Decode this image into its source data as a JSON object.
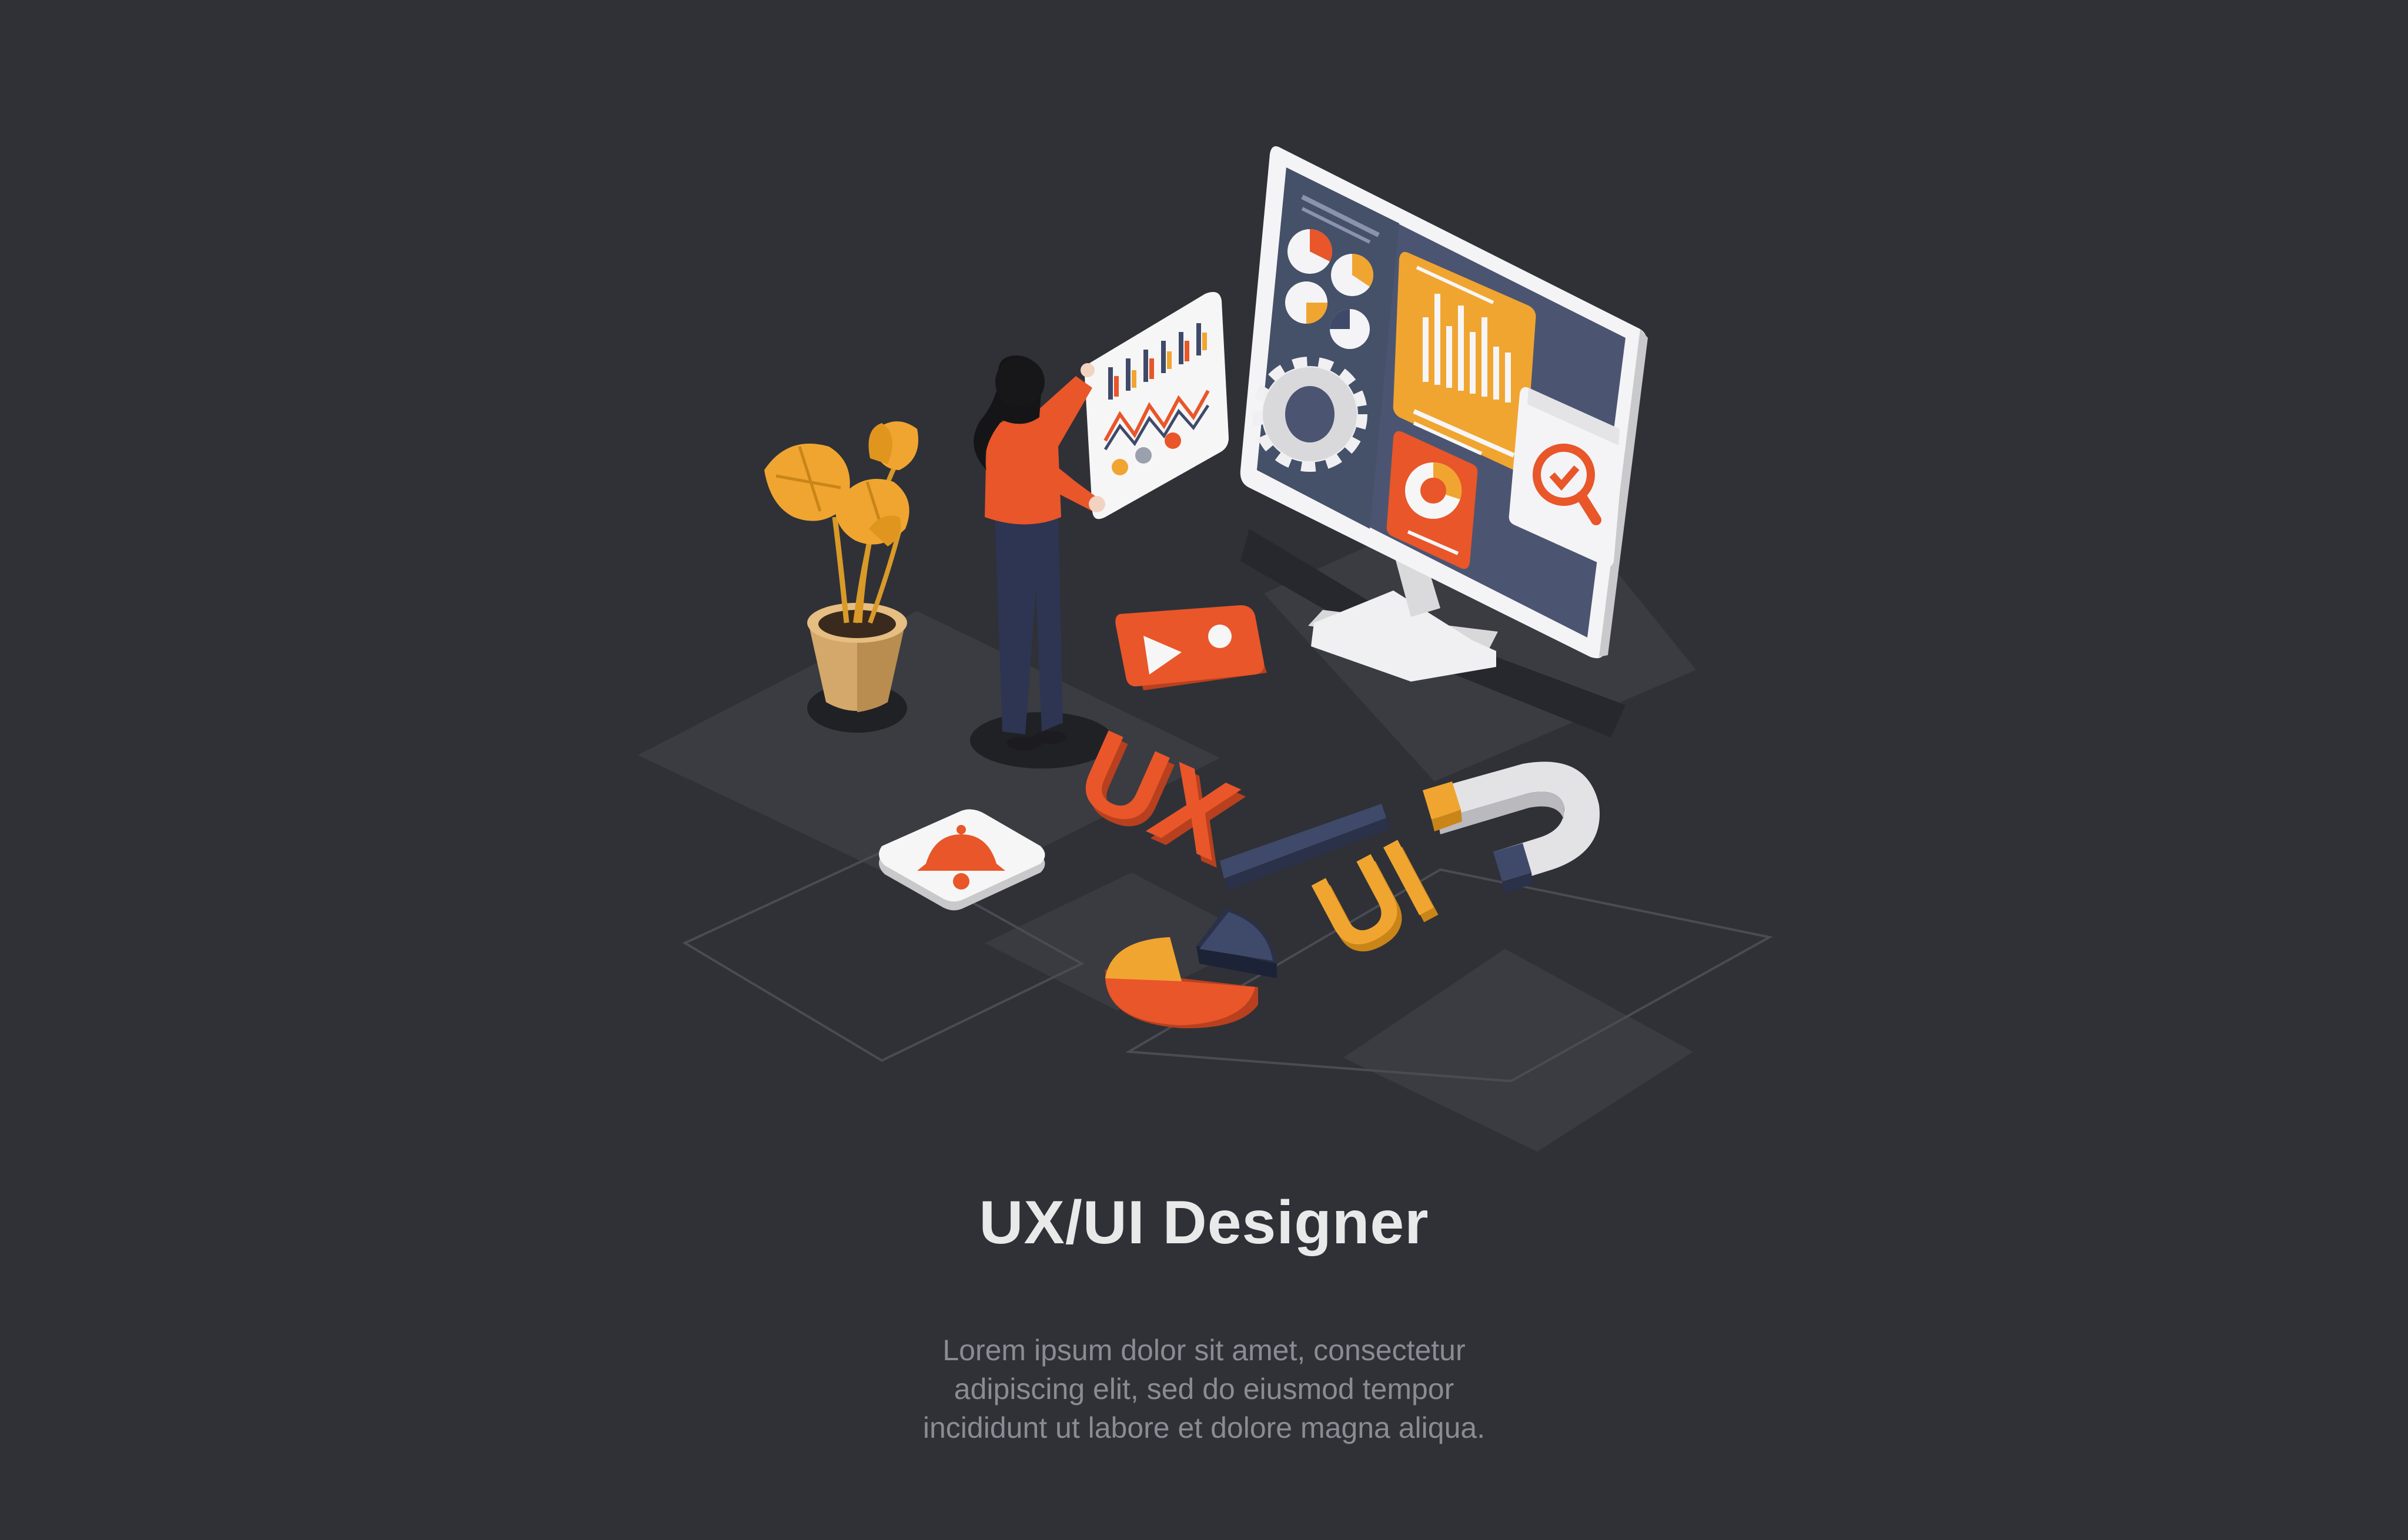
{
  "illustration": {
    "title": "UX/UI Designer",
    "description": [
      "Lorem ipsum dolor sit amet, consectetur",
      "adipiscing elit, sed do eiusmod tempor",
      "incididunt ut labore et dolore magna aliqua."
    ],
    "letters": {
      "ux": "UX",
      "ui": "UI"
    },
    "icons": [
      "monitor-icon",
      "pie-chart-icon",
      "bar-chart-icon",
      "gear-icon",
      "donut-chart-icon",
      "search-check-icon",
      "image-icon",
      "bell-icon",
      "magnet-icon",
      "plant-icon",
      "tablet-icon",
      "designer-person-icon"
    ],
    "colors": {
      "background": "#2f3137",
      "orange": "#e8562a",
      "yellow": "#f0a531",
      "navy": "#3f4a6a",
      "screen": "#4a5470",
      "white": "#f2f2f2",
      "text": "#e9e9ea",
      "muted_text": "#8a8c93"
    }
  }
}
